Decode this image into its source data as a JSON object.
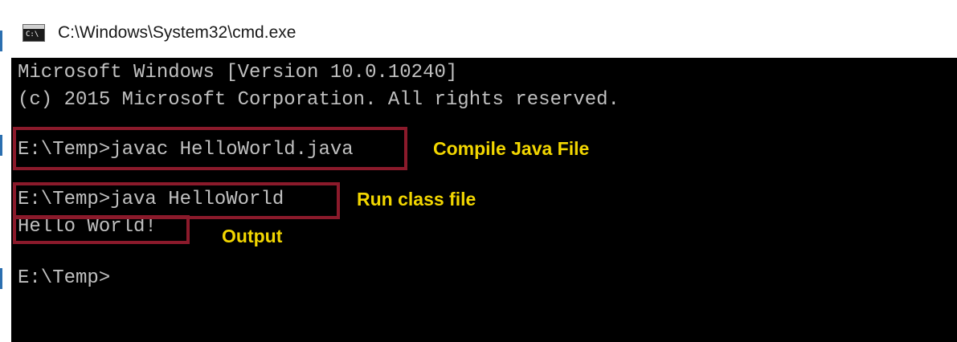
{
  "window": {
    "title": "C:\\Windows\\System32\\cmd.exe",
    "icon": "cmd-console-icon",
    "icon_text": "C:\\"
  },
  "console": {
    "lines": [
      "Microsoft Windows [Version 10.0.10240]",
      "(c) 2015 Microsoft Corporation. All rights reserved.",
      "",
      "E:\\Temp>javac HelloWorld.java",
      "",
      "E:\\Temp>java HelloWorld",
      "Hello World!",
      "",
      "E:\\Temp>"
    ]
  },
  "annotations": {
    "compile": "Compile Java File",
    "run": "Run class file",
    "output": "Output"
  },
  "colors": {
    "console_bg": "#000000",
    "console_text": "#c0c0c0",
    "highlight_border": "#8b1a2b",
    "annotation_text": "#f2d600"
  }
}
